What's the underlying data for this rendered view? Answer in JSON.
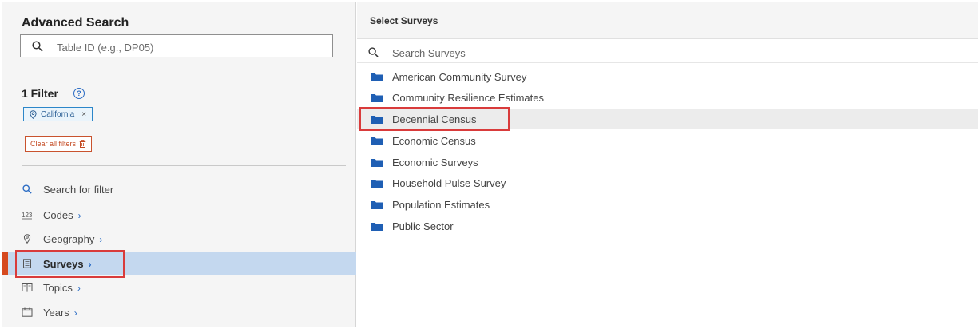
{
  "left": {
    "title": "Advanced Search",
    "table_search": {
      "placeholder": "Table ID (e.g., DP05)"
    },
    "filter_count_label": "1 Filter",
    "help_glyph": "?",
    "chips": [
      {
        "label": "California",
        "remove_glyph": "×",
        "icon": "map-pin-icon"
      }
    ],
    "clear_all_label": "Clear all filters",
    "nav": [
      {
        "label": "Search for filter",
        "icon": "search-icon",
        "chevron": ""
      },
      {
        "label": "Codes",
        "icon": "codes-icon",
        "chevron": "›"
      },
      {
        "label": "Geography",
        "icon": "map-pin-icon",
        "chevron": "›"
      },
      {
        "label": "Surveys",
        "icon": "survey-icon",
        "chevron": "›",
        "active": true
      },
      {
        "label": "Topics",
        "icon": "book-icon",
        "chevron": "›"
      },
      {
        "label": "Years",
        "icon": "calendar-icon",
        "chevron": "›"
      }
    ]
  },
  "right": {
    "title": "Select Surveys",
    "search": {
      "placeholder": "Search Surveys"
    },
    "surveys": [
      {
        "label": "American Community Survey"
      },
      {
        "label": "Community Resilience Estimates"
      },
      {
        "label": "Decennial Census",
        "selected": true
      },
      {
        "label": "Economic Census"
      },
      {
        "label": "Economic Surveys"
      },
      {
        "label": "Household Pulse Survey"
      },
      {
        "label": "Population Estimates"
      },
      {
        "label": "Public Sector"
      }
    ]
  },
  "colors": {
    "accent_blue": "#2b6cc4",
    "folder_blue": "#1f5fb4",
    "active_bar": "#d64a1f",
    "highlight_red": "#d93b3b",
    "active_row": "#c4d8ef"
  }
}
